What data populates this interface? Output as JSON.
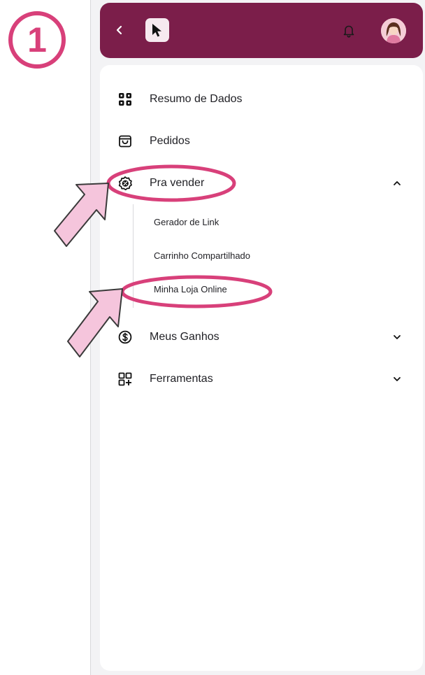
{
  "step": {
    "number": "1",
    "color": "#d8407a"
  },
  "header": {
    "background": "#7b1e4a",
    "back_icon": "chevron-left-icon",
    "logo_icon": "cursor-pointer-icon",
    "bell_icon": "bell-icon",
    "avatar_icon": "user-avatar"
  },
  "menu": {
    "items": [
      {
        "label": "Resumo de Dados",
        "icon": "dashboard-grid-icon"
      },
      {
        "label": "Pedidos",
        "icon": "shopping-bag-icon"
      },
      {
        "label": "Pra vender",
        "icon": "tag-badge-icon",
        "expanded": true,
        "children": [
          {
            "label": "Gerador de Link"
          },
          {
            "label": "Carrinho Compartilhado"
          },
          {
            "label": "Minha Loja Online"
          }
        ]
      },
      {
        "label": "Meus Ganhos",
        "icon": "dollar-circle-icon",
        "expanded": false
      },
      {
        "label": "Ferramentas",
        "icon": "apps-add-icon",
        "expanded": false
      }
    ]
  },
  "annotations": {
    "highlight_color": "#d8407a",
    "arrow_fill": "#f5c5dc",
    "arrow_stroke": "#3a3a3a"
  }
}
